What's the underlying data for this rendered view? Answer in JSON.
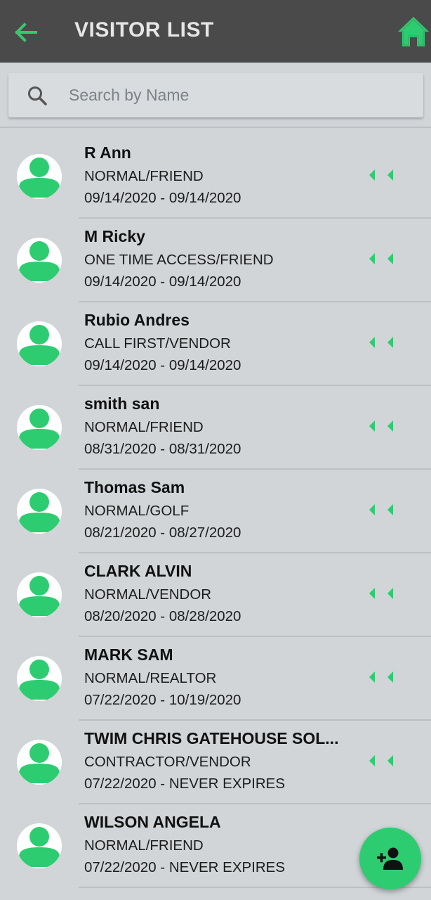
{
  "header": {
    "title": "VISITOR LIST",
    "back_icon": "arrow-left-icon",
    "home_icon": "home-icon"
  },
  "search": {
    "placeholder": "Search by Name",
    "value": ""
  },
  "visitors": [
    {
      "name": "R Ann",
      "type": "NORMAL/FRIEND",
      "dates": "09/14/2020 - 09/14/2020"
    },
    {
      "name": "M Ricky",
      "type": "ONE TIME ACCESS/FRIEND",
      "dates": "09/14/2020 - 09/14/2020"
    },
    {
      "name": "Rubio Andres",
      "type": "CALL FIRST/VENDOR",
      "dates": "09/14/2020 - 09/14/2020"
    },
    {
      "name": "smith san",
      "type": "NORMAL/FRIEND",
      "dates": "08/31/2020 - 08/31/2020"
    },
    {
      "name": "Thomas Sam",
      "type": "NORMAL/GOLF",
      "dates": "08/21/2020 - 08/27/2020"
    },
    {
      "name": "CLARK ALVIN",
      "type": "NORMAL/VENDOR",
      "dates": "08/20/2020 - 08/28/2020"
    },
    {
      "name": "MARK SAM",
      "type": "NORMAL/REALTOR",
      "dates": "07/22/2020 - 10/19/2020"
    },
    {
      "name": "TWIM CHRIS GATEHOUSE SOL...",
      "type": "CONTRACTOR/VENDOR",
      "dates": "07/22/2020 - NEVER EXPIRES"
    },
    {
      "name": "WILSON ANGELA",
      "type": "NORMAL/FRIEND",
      "dates": "07/22/2020 - NEVER EXPIRES"
    }
  ],
  "fab": {
    "icon": "add-person-icon"
  },
  "colors": {
    "accent": "#2ecc71",
    "header_bg": "#4a4a4a",
    "background": "#d1d5d8"
  }
}
